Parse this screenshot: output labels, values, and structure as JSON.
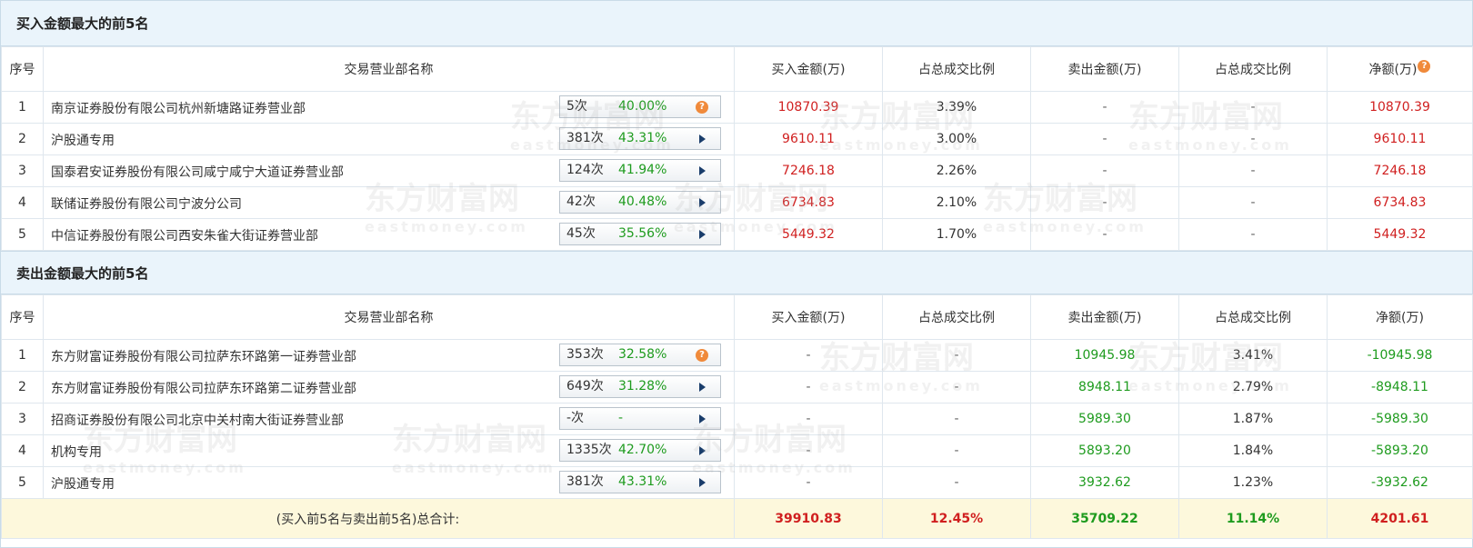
{
  "buy_section": {
    "title": "买入金额最大的前5名",
    "headers": [
      "序号",
      "交易营业部名称",
      "买入金额(万)",
      "占总成交比例",
      "卖出金额(万)",
      "占总成交比例",
      "净额(万)"
    ],
    "rows": [
      {
        "idx": "1",
        "name": "南京证券股份有限公司杭州新塘路证券营业部",
        "times": "5次",
        "pct": "40.00%",
        "icon": "help",
        "buy": "10870.39",
        "buy_pct": "3.39%",
        "sell": "-",
        "sell_pct": "-",
        "net": "10870.39"
      },
      {
        "idx": "2",
        "name": "沪股通专用",
        "times": "381次",
        "pct": "43.31%",
        "icon": "arrow",
        "buy": "9610.11",
        "buy_pct": "3.00%",
        "sell": "-",
        "sell_pct": "-",
        "net": "9610.11"
      },
      {
        "idx": "3",
        "name": "国泰君安证券股份有限公司咸宁咸宁大道证券营业部",
        "times": "124次",
        "pct": "41.94%",
        "icon": "arrow",
        "buy": "7246.18",
        "buy_pct": "2.26%",
        "sell": "-",
        "sell_pct": "-",
        "net": "7246.18"
      },
      {
        "idx": "4",
        "name": "联储证券股份有限公司宁波分公司",
        "times": "42次",
        "pct": "40.48%",
        "icon": "arrow",
        "buy": "6734.83",
        "buy_pct": "2.10%",
        "sell": "-",
        "sell_pct": "-",
        "net": "6734.83"
      },
      {
        "idx": "5",
        "name": "中信证券股份有限公司西安朱雀大街证券营业部",
        "times": "45次",
        "pct": "35.56%",
        "icon": "arrow",
        "buy": "5449.32",
        "buy_pct": "1.70%",
        "sell": "-",
        "sell_pct": "-",
        "net": "5449.32"
      }
    ]
  },
  "sell_section": {
    "title": "卖出金额最大的前5名",
    "headers": [
      "序号",
      "交易营业部名称",
      "买入金额(万)",
      "占总成交比例",
      "卖出金额(万)",
      "占总成交比例",
      "净额(万)"
    ],
    "rows": [
      {
        "idx": "1",
        "name": "东方财富证券股份有限公司拉萨东环路第一证券营业部",
        "times": "353次",
        "pct": "32.58%",
        "icon": "help",
        "buy": "-",
        "buy_pct": "-",
        "sell": "10945.98",
        "sell_pct": "3.41%",
        "net": "-10945.98"
      },
      {
        "idx": "2",
        "name": "东方财富证券股份有限公司拉萨东环路第二证券营业部",
        "times": "649次",
        "pct": "31.28%",
        "icon": "arrow",
        "buy": "-",
        "buy_pct": "-",
        "sell": "8948.11",
        "sell_pct": "2.79%",
        "net": "-8948.11"
      },
      {
        "idx": "3",
        "name": "招商证券股份有限公司北京中关村南大街证券营业部",
        "times": "-次",
        "pct": "-",
        "icon": "arrow",
        "buy": "-",
        "buy_pct": "-",
        "sell": "5989.30",
        "sell_pct": "1.87%",
        "net": "-5989.30"
      },
      {
        "idx": "4",
        "name": "机构专用",
        "times": "1335次",
        "pct": "42.70%",
        "icon": "arrow",
        "buy": "-",
        "buy_pct": "-",
        "sell": "5893.20",
        "sell_pct": "1.84%",
        "net": "-5893.20"
      },
      {
        "idx": "5",
        "name": "沪股通专用",
        "times": "381次",
        "pct": "43.31%",
        "icon": "arrow",
        "buy": "-",
        "buy_pct": "-",
        "sell": "3932.62",
        "sell_pct": "1.23%",
        "net": "-3932.62"
      }
    ]
  },
  "total": {
    "label": "(买入前5名与卖出前5名)总合计:",
    "buy": "39910.83",
    "buy_pct": "12.45%",
    "sell": "35709.22",
    "sell_pct": "11.14%",
    "net": "4201.61"
  },
  "icons": {
    "help": "?",
    "help_icon_color": "#f08a3b"
  },
  "watermark": {
    "brand": "东方财富网",
    "domain": "eastmoney.com"
  },
  "colors": {
    "positive": "#d01f1f",
    "negative": "#1e9b1e",
    "header_bg": "#eaf4fb",
    "total_bg": "#fdf8dc"
  }
}
